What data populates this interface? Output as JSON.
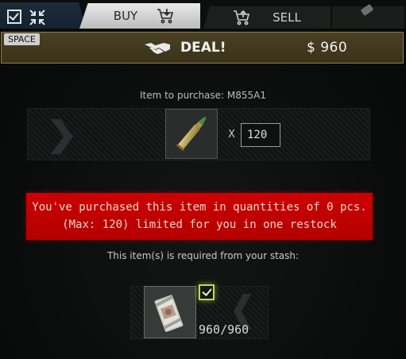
{
  "tabs": {
    "buy_label": "BUY",
    "sell_label": "SELL"
  },
  "deal": {
    "key_hint": "SPACE",
    "label": "DEAL!",
    "price": "$ 960"
  },
  "purchase": {
    "title": "Item to purchase: M855A1",
    "multiplier": "X",
    "quantity": "120"
  },
  "warning": {
    "line1": "You've purchased this item in quantities of 0 pcs.",
    "line2": "(Max: 120) limited for you in one restock"
  },
  "requirement": {
    "label": "This item(s) is required from your stash:",
    "count": "960/960",
    "checked": true
  },
  "colors": {
    "deal_bar": "#423a1f",
    "warning_bg": "#c40000",
    "active_tab": "#d6d6d6"
  }
}
